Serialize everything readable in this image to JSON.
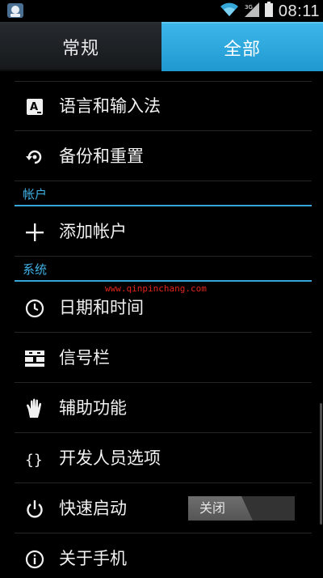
{
  "status_bar": {
    "time": "08:11",
    "icons": [
      "notification-app-icon",
      "wifi-icon",
      "signal-icon",
      "battery-icon"
    ]
  },
  "tabs": [
    {
      "label": "常规",
      "selected": false
    },
    {
      "label": "全部",
      "selected": true
    }
  ],
  "sections": {
    "accounts": "帐户",
    "system": "系统"
  },
  "items": {
    "language_input": "语言和输入法",
    "backup_reset": "备份和重置",
    "add_account": "添加帐户",
    "date_time": "日期和时间",
    "signal_bar": "信号栏",
    "accessibility": "辅助功能",
    "developer_options": "开发人员选项",
    "quick_boot": "快速启动",
    "about_phone": "关于手机"
  },
  "quick_boot_toggle": "关闭",
  "watermark": "www.qinpinchang.com",
  "colors": {
    "accent": "#33b5e5",
    "background": "#000000",
    "watermark": "#e3241b"
  }
}
